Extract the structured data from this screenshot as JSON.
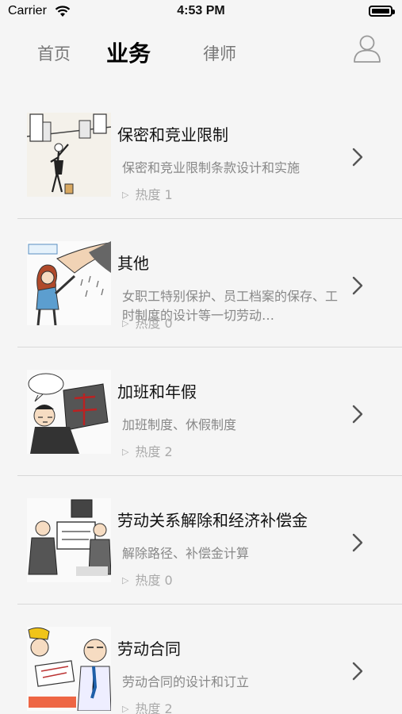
{
  "status_bar": {
    "carrier": "Carrier",
    "time": "4:53 PM"
  },
  "nav": {
    "tabs": [
      {
        "label": "首页",
        "selected": false
      },
      {
        "label": "业务",
        "selected": true
      },
      {
        "label": "律师",
        "selected": false
      }
    ],
    "profile_icon": "user-outline-icon"
  },
  "items": [
    {
      "title": "保密和竞业限制",
      "desc": "保密和竞业限制条款设计和实施",
      "heat": "热度 1"
    },
    {
      "title": "其他",
      "desc": "女职工特别保护、员工档案的保存、工时制度的设计等一切劳动…",
      "heat": "热度 0"
    },
    {
      "title": "加班和年假",
      "desc": "加班制度、休假制度",
      "heat": "热度 2"
    },
    {
      "title": "劳动关系解除和经济补偿金",
      "desc": "解除路径、补偿金计算",
      "heat": "热度 0"
    },
    {
      "title": "劳动合同",
      "desc": "劳动合同的设计和订立",
      "heat": "热度 2"
    }
  ],
  "colors": {
    "background": "#f5f5f5",
    "divider": "#d8d8d8",
    "title": "#111111",
    "desc": "#888888"
  }
}
